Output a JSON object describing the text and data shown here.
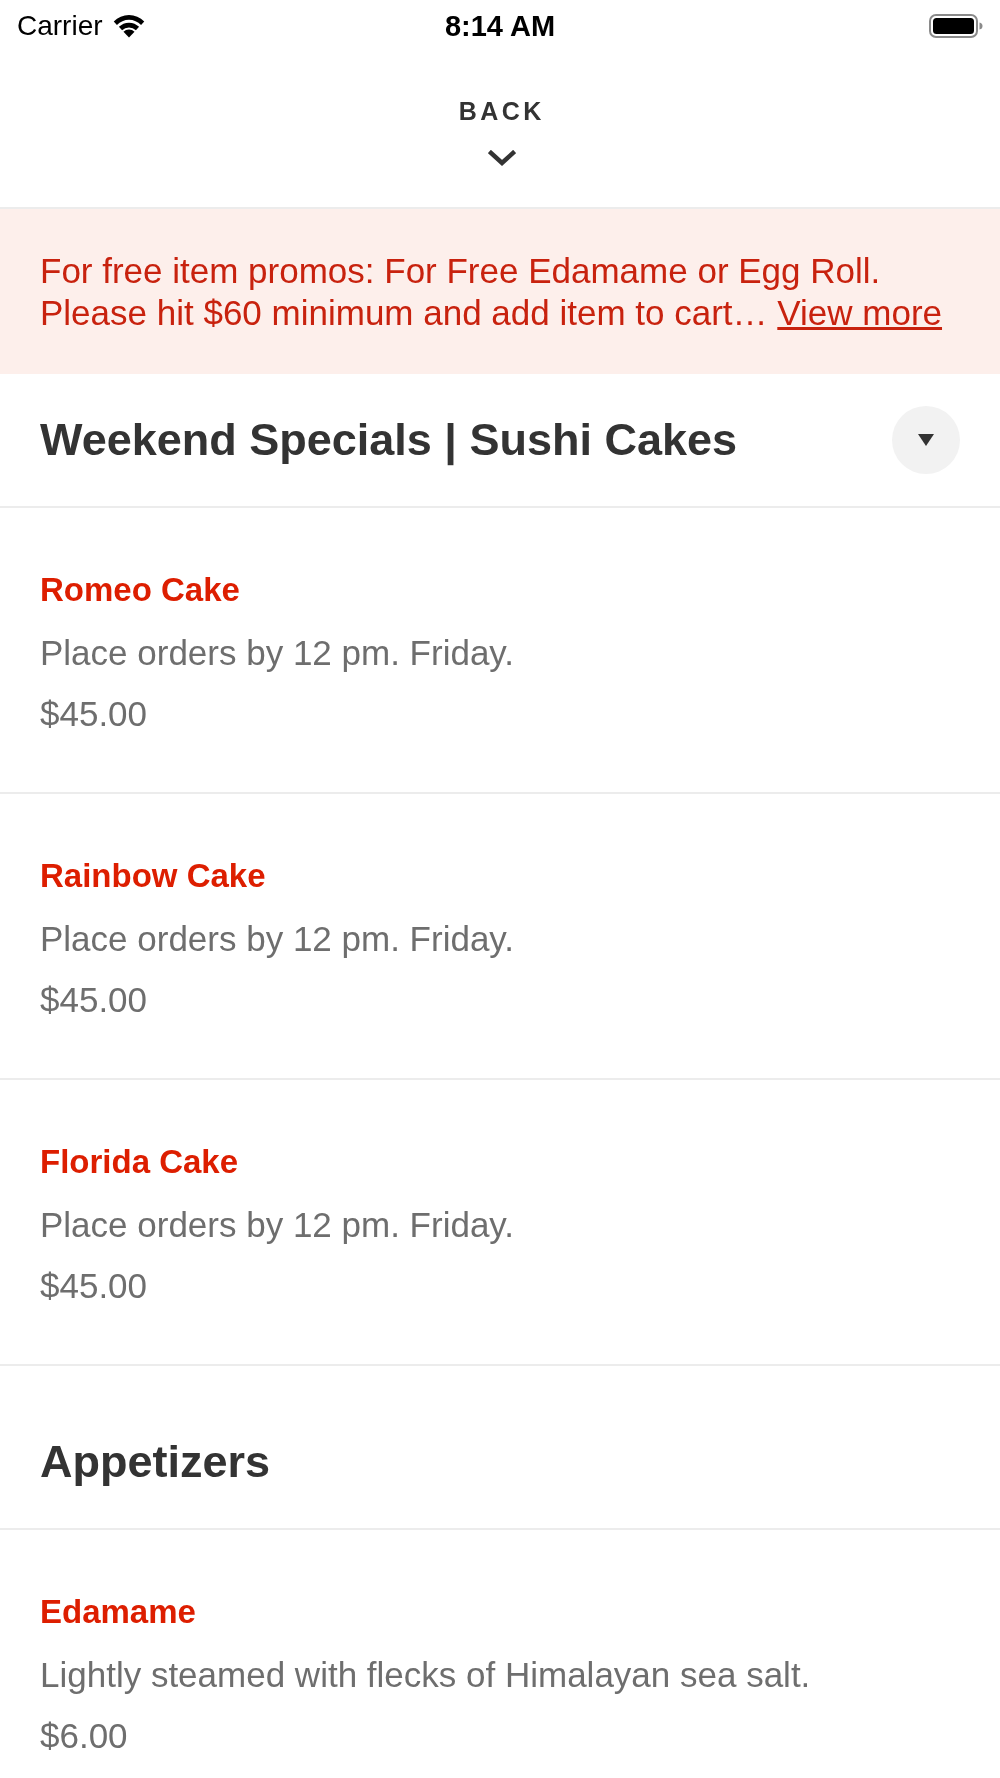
{
  "status_bar": {
    "carrier": "Carrier",
    "time": "8:14 AM"
  },
  "header": {
    "back_label": "BACK"
  },
  "promo_banner": {
    "text": "For free item promos: For Free Edamame or Egg Roll. Please hit $60 minimum and add item to cart…",
    "link": "View more"
  },
  "sections": [
    {
      "title": "Weekend Specials | Sushi Cakes",
      "toggle": true,
      "items": [
        {
          "name": "Romeo Cake",
          "description": "Place orders by 12 pm. Friday.",
          "price": "$45.00"
        },
        {
          "name": "Rainbow Cake",
          "description": "Place orders by 12 pm. Friday.",
          "price": "$45.00"
        },
        {
          "name": "Florida Cake",
          "description": "Place orders by 12 pm. Friday.",
          "price": "$45.00"
        }
      ]
    },
    {
      "title": "Appetizers",
      "toggle": false,
      "items": [
        {
          "name": "Edamame",
          "description": "Lightly steamed with flecks of Himalayan sea salt.",
          "price": "$6.00"
        }
      ]
    }
  ]
}
